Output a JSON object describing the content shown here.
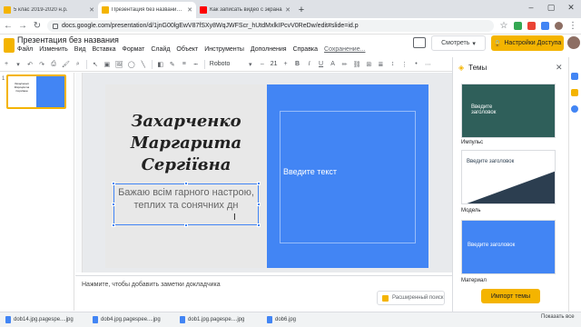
{
  "browser": {
    "tabs": [
      {
        "title": "5 клас 2019-2020 н.р.",
        "favicon_color": "#f4b400"
      },
      {
        "title": "Презентация без названия - G",
        "favicon_color": "#f4b400"
      },
      {
        "title": "Как записать видео с экрана",
        "favicon_color": "#ff0000"
      }
    ],
    "url": "docs.google.com/presentation/d/1jnG00lgEwV87fSXy8WqJWFScr_hUtdMxlkIPcvV0ReDw/edit#slide=id.p"
  },
  "app": {
    "title": "Презентация без названия",
    "menu": [
      "Файл",
      "Изменить",
      "Вид",
      "Вставка",
      "Формат",
      "Слайд",
      "Объект",
      "Инструменты",
      "Дополнения",
      "Справка"
    ],
    "saving": "Сохранение...",
    "present_label": "Смотреть",
    "share_label": "Настройки Доступа"
  },
  "toolbar": {
    "font": "Roboto",
    "size": "21"
  },
  "filmstrip": {
    "slide_number": "1",
    "thumb_text": "Захарченко Маргарита Сергіївна"
  },
  "slide": {
    "name_lines": [
      "Захарченко",
      "Маргарита",
      "Сергіївна"
    ],
    "subtitle_lines": [
      "Бажаю всім гарного настрою,",
      "теплих та сонячних дн"
    ],
    "right_title": "Введите текст"
  },
  "notes": {
    "placeholder": "Нажмите, чтобы добавить заметки докладчика",
    "explore_label": "Расширенный поиск"
  },
  "themes_panel": {
    "title": "Темы",
    "themes": [
      {
        "name": "Импульс",
        "preview_text": "Введите заголовок",
        "bg": "#2f5f5a"
      },
      {
        "name": "Модель",
        "preview_text": "Введите заголовок",
        "bg": "#ffffff"
      },
      {
        "name": "Материал",
        "preview_text": "Введите заголовок",
        "bg": "#4285f4"
      }
    ],
    "import_label": "Импорт темы"
  },
  "downloads": {
    "items": [
      "dob14.jpg.pagespe....jpg",
      "dob4.jpg.pagespee....jpg",
      "dob1.jpg.pagespe....jpg",
      "dob6.jpg"
    ],
    "show_all": "Показать все"
  }
}
